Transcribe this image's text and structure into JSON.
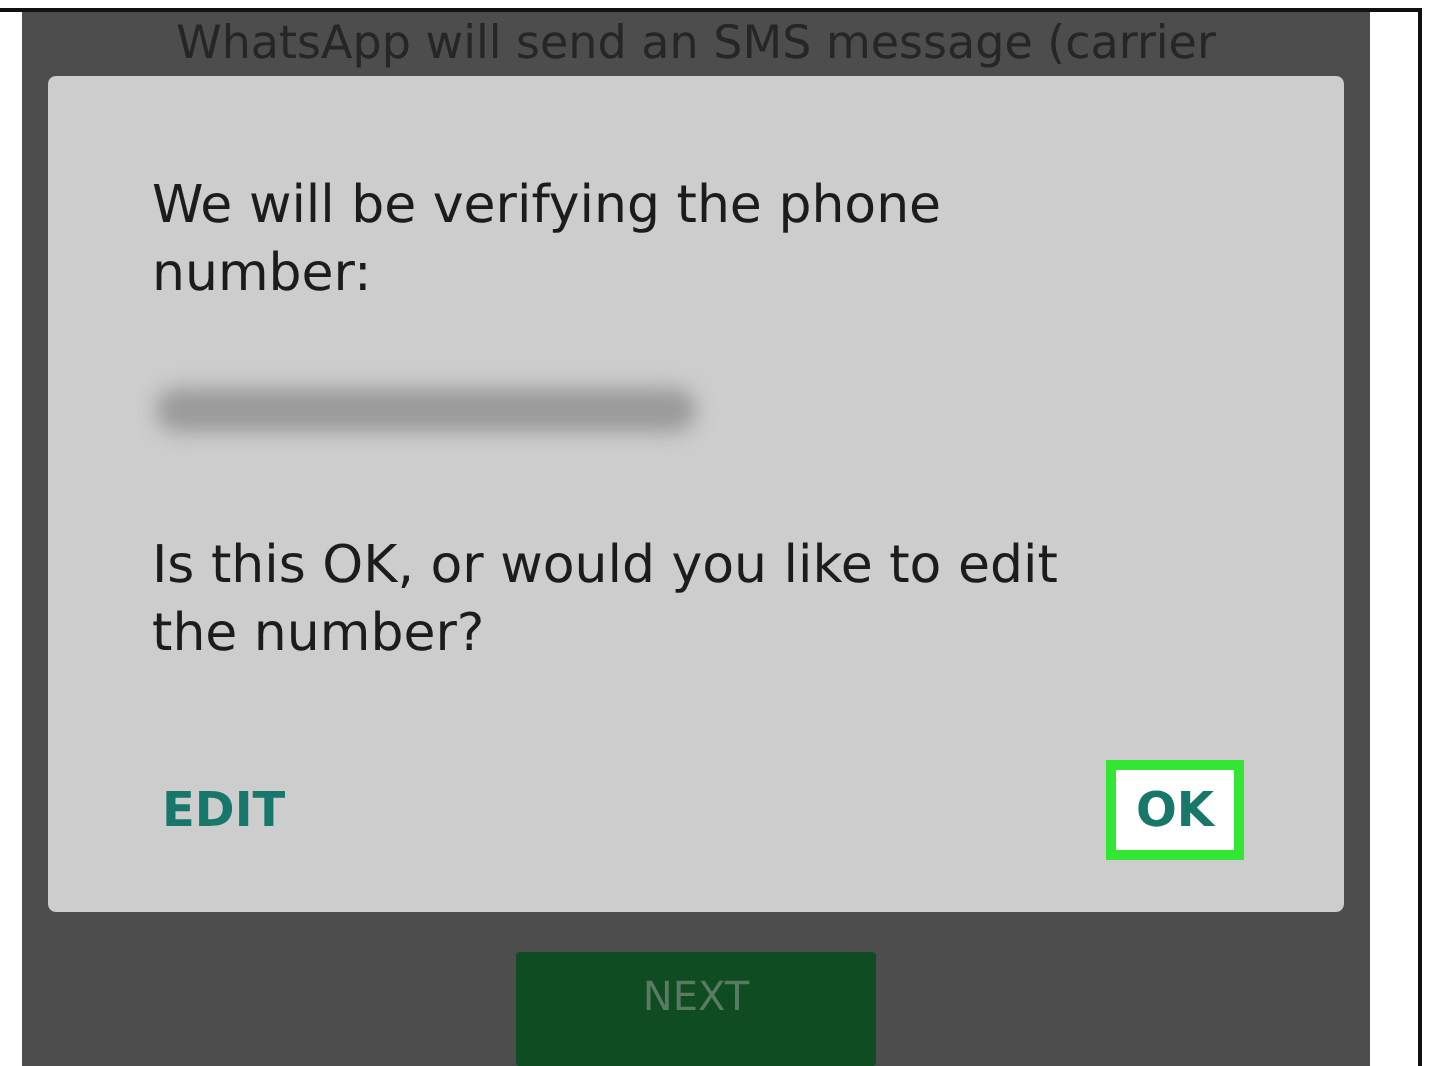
{
  "background_text": "WhatsApp will send an SMS message (carrier",
  "dialog": {
    "message": "We will be verifying the phone number:",
    "detail": "Is this OK, or would you like to edit the number?",
    "buttons": [
      {
        "label": "EDIT",
        "highlighted": false
      },
      {
        "label": "OK",
        "highlighted": true
      }
    ]
  },
  "next_button": {
    "label": "NEXT"
  }
}
